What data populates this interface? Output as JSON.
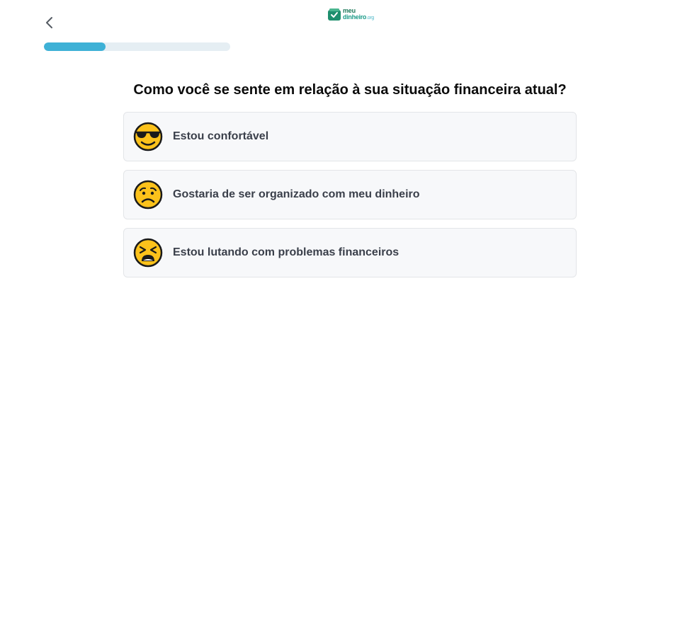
{
  "header": {
    "back_icon": "chevron-left-icon",
    "logo": {
      "line1": "meu",
      "line2": "dinheiro",
      "tld": ".org",
      "icon": "wallet-check-icon"
    }
  },
  "progress": {
    "fraction": 0.33,
    "color": "#3eb1d6"
  },
  "question": "Como você se sente em relação à sua situação financeira atual?",
  "options": [
    {
      "label": "Estou confortável",
      "icon": "sunglasses-face-emoji"
    },
    {
      "label": "Gostaria de ser organizado com meu dinheiro",
      "icon": "worried-face-emoji"
    },
    {
      "label": "Estou lutando com problemas financeiros",
      "icon": "tired-face-emoji"
    }
  ]
}
